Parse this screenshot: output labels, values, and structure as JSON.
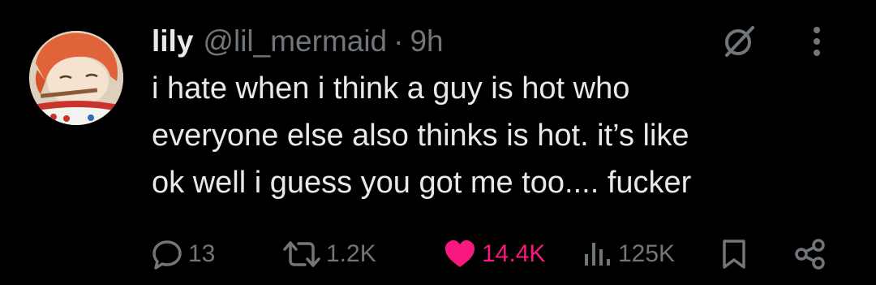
{
  "tweet": {
    "author": {
      "display_name": "lily",
      "handle": "@lil_mermaid",
      "separator": "·",
      "time": "9h",
      "avatar": "avatar-image"
    },
    "header_icons": [
      "grok-icon",
      "more-icon"
    ],
    "text": "i hate when i think a guy is hot who\neveryone else also thinks is hot. it’s like\nok well i guess you got me too.... fucker",
    "actions": {
      "reply": {
        "icon": "reply-icon",
        "count": "13"
      },
      "repost": {
        "icon": "repost-icon",
        "count": "1.2K"
      },
      "like": {
        "icon": "heart-filled-icon",
        "count": "14.4K",
        "liked": true
      },
      "views": {
        "icon": "views-icon",
        "count": "125K"
      },
      "bookmark": {
        "icon": "bookmark-icon"
      },
      "share": {
        "icon": "share-icon"
      }
    }
  },
  "colors": {
    "background": "#000000",
    "primary_text": "#e7e9ea",
    "secondary_text": "#71767b",
    "like_pink": "#f91880"
  }
}
